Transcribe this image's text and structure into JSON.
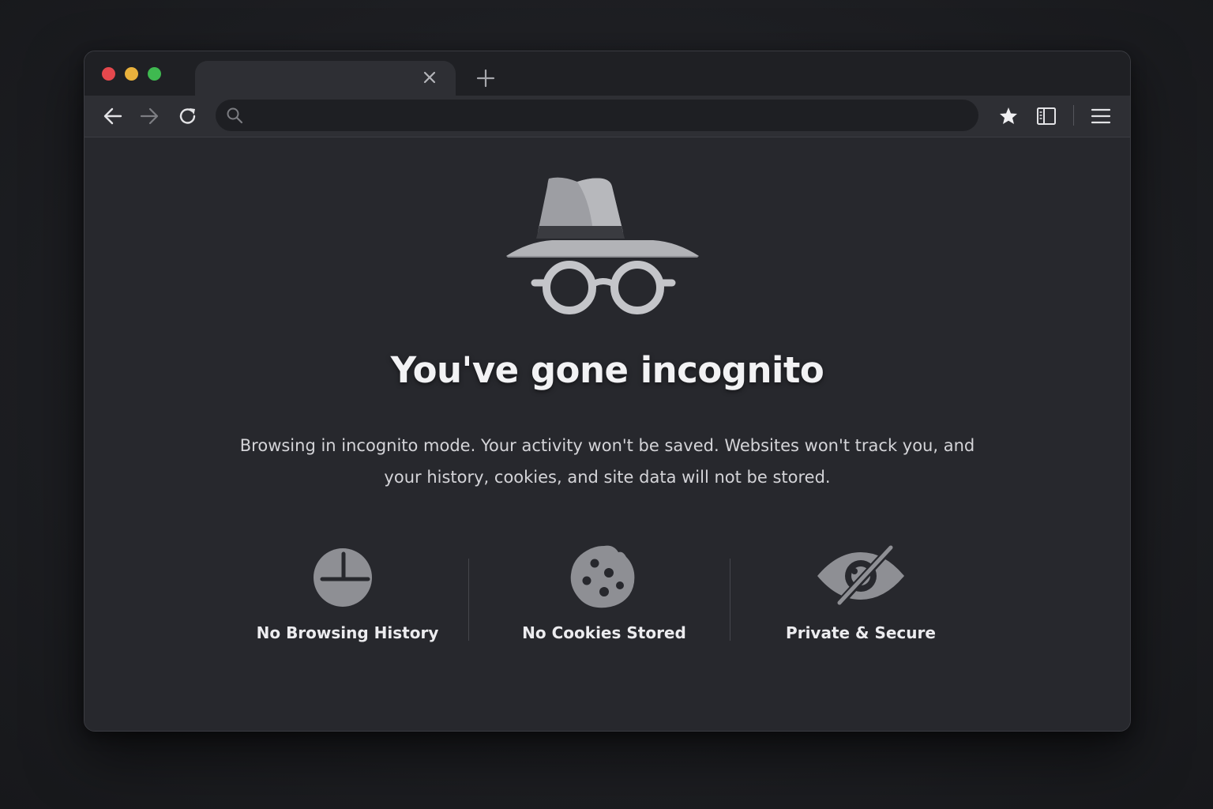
{
  "browser": {
    "tab": {
      "title": "",
      "close_icon": "close-icon"
    },
    "new_tab_icon": "plus-icon",
    "toolbar": {
      "back_icon": "arrow-left-icon",
      "forward_icon": "arrow-right-icon",
      "reload_icon": "reload-icon",
      "address_value": "",
      "address_placeholder": "",
      "search_icon": "search-icon",
      "bookmark_icon": "star-icon",
      "sidebar_icon": "sidebar-icon",
      "menu_icon": "hamburger-menu-icon"
    },
    "window_controls": {
      "close_color": "#e5484d",
      "minimize_color": "#e9b13c",
      "maximize_color": "#3fb950"
    }
  },
  "page": {
    "hero_icon": "incognito-icon",
    "title": "You've gone incognito",
    "description": "Browsing in incognito mode. Your activity won't be saved. Websites won't track you, and your history, cookies, and site data will not be stored.",
    "features": [
      {
        "icon": "clock-icon",
        "label": "No Browsing History"
      },
      {
        "icon": "cookie-icon",
        "label": "No Cookies Stored"
      },
      {
        "icon": "eye-off-icon",
        "label": "Private & Secure"
      }
    ]
  },
  "colors": {
    "background": "#1c1d21",
    "window": "#26272c",
    "tabstrip": "#1f2024",
    "toolbar": "#2e2f34",
    "omnibox": "#1e1f23",
    "icon_gray": "#8e8f94",
    "text_primary": "#f2f2f4"
  }
}
